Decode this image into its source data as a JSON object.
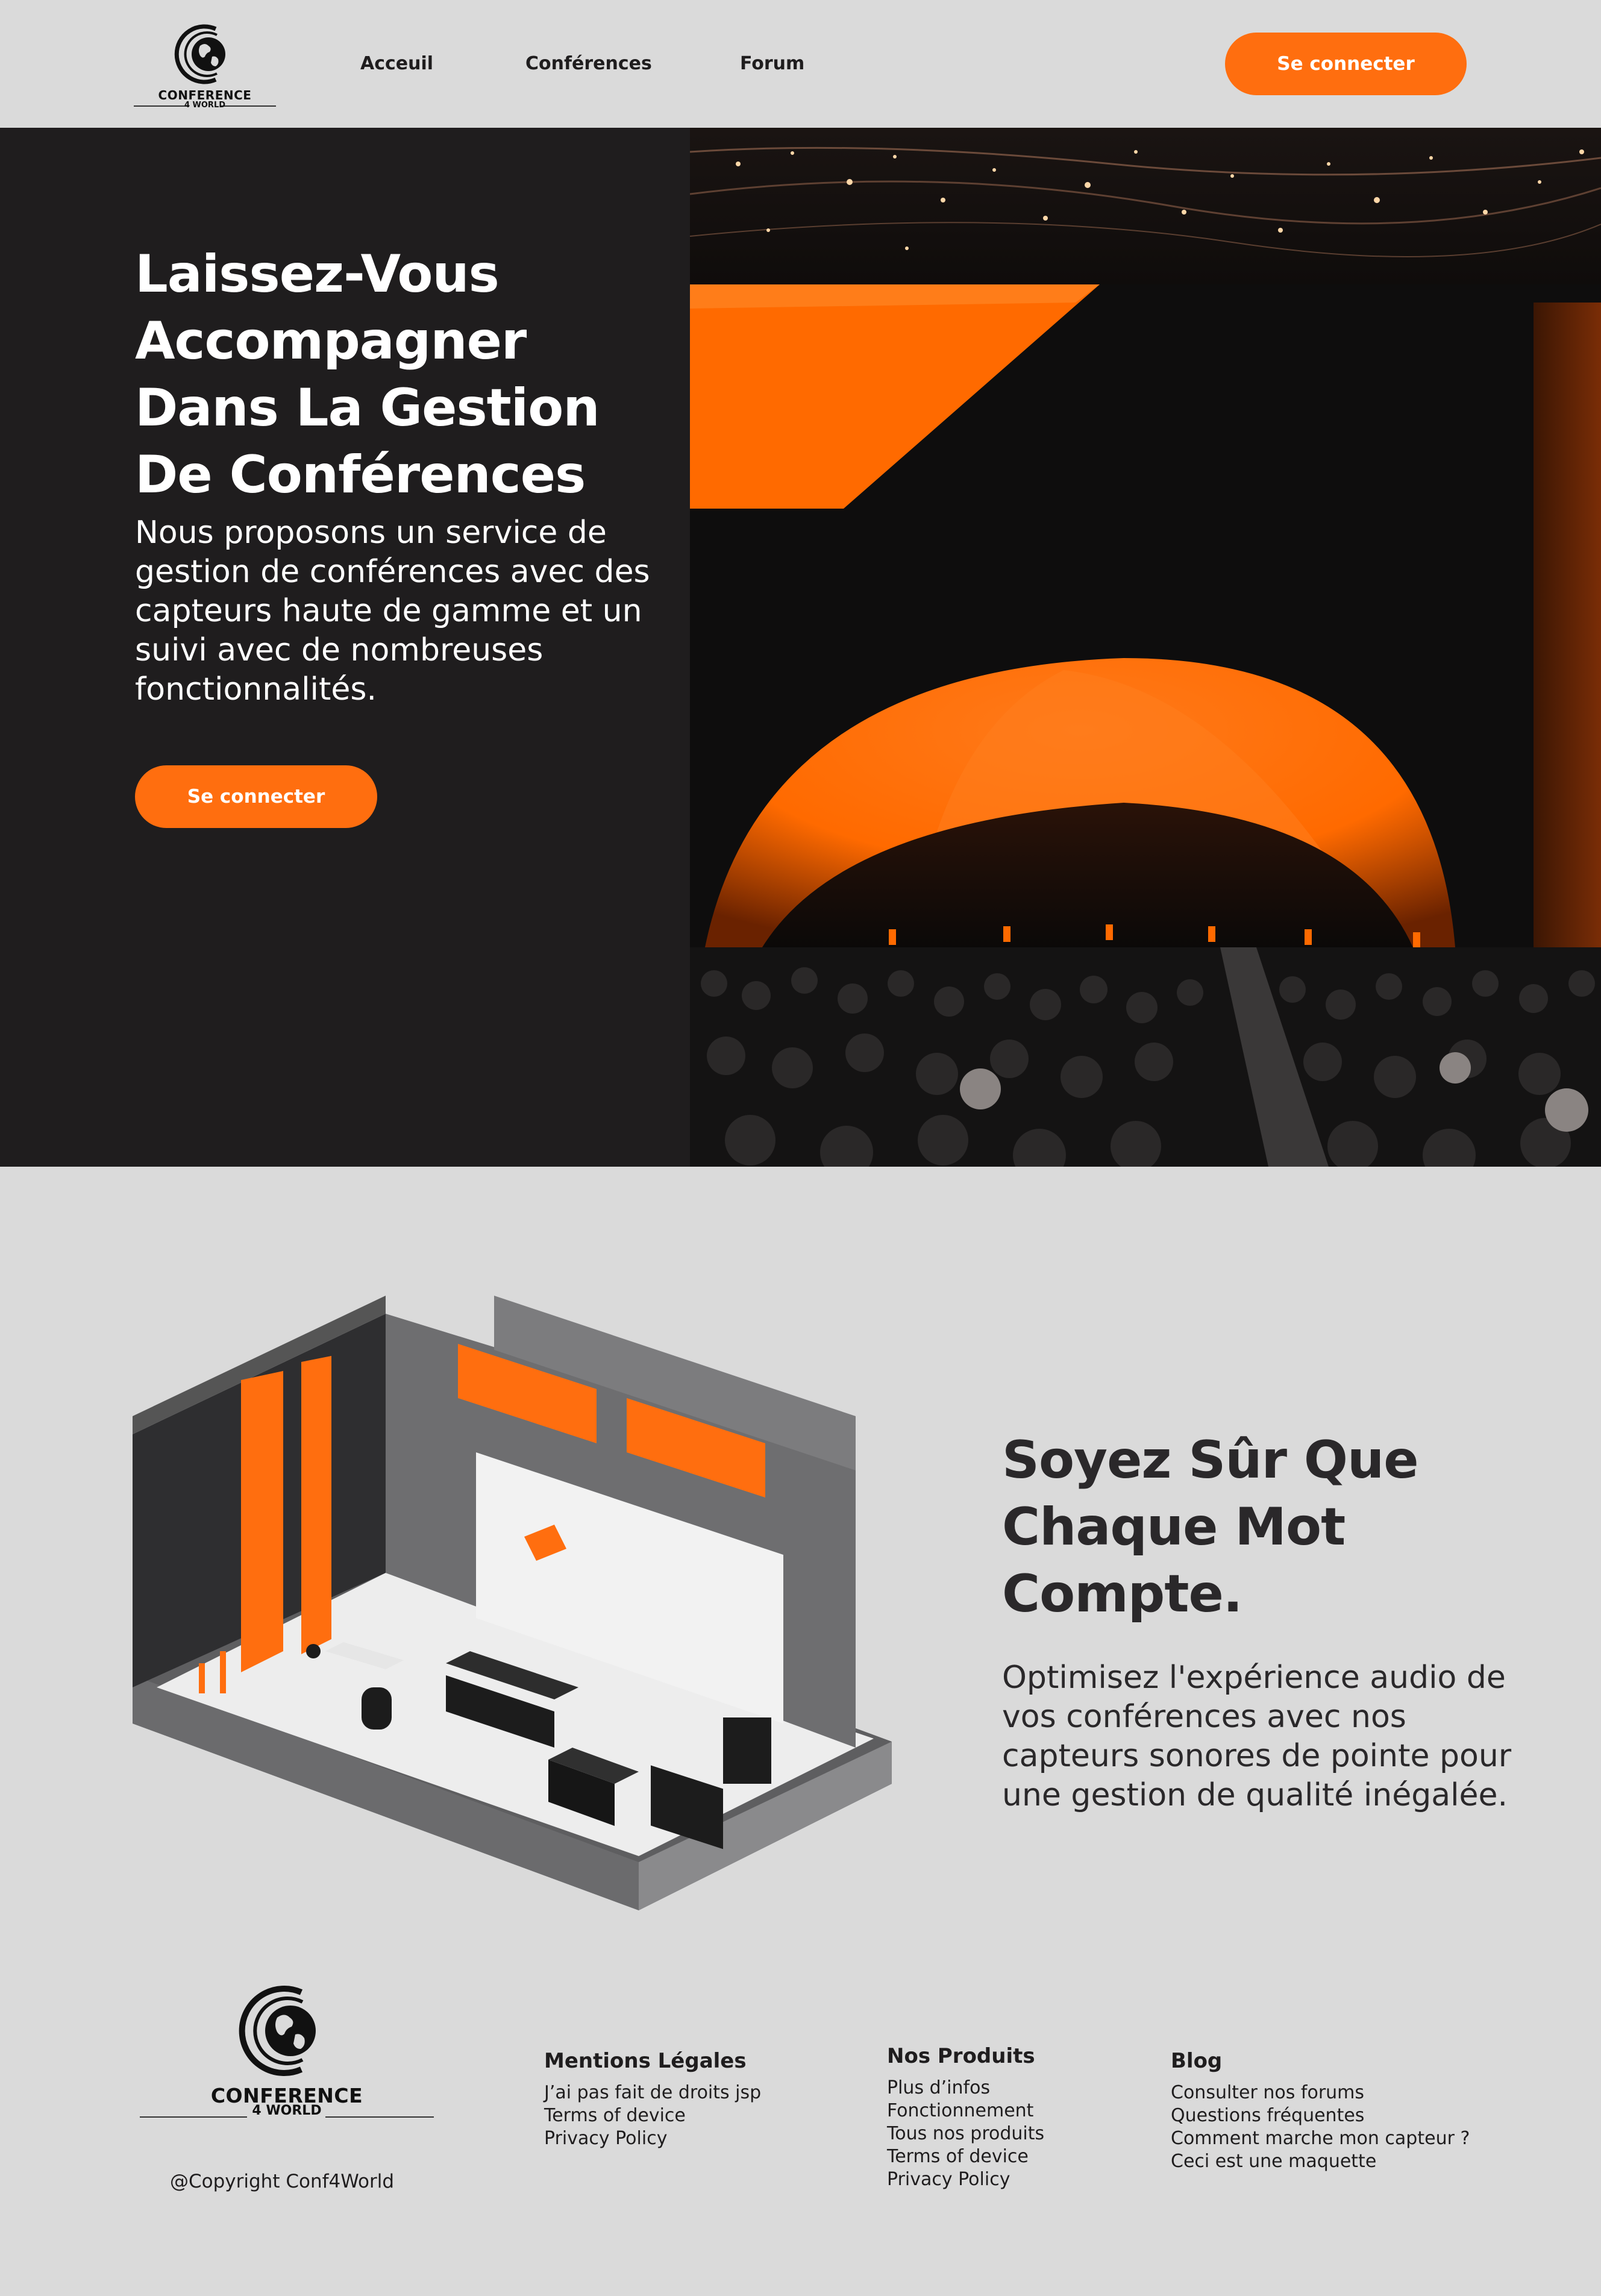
{
  "header": {
    "logo": {
      "line1": "CONFERENCE",
      "line2": "4 WORLD"
    },
    "nav": [
      "Acceuil",
      "Conférences",
      "Forum"
    ],
    "login_label": "Se connecter"
  },
  "hero": {
    "title": "Laissez-Vous Accompagner Dans La Gestion De Conférences",
    "text": "Nous proposons un service de gestion de conférences avec des capteurs haute de gamme et un suivi avec de nombreuses fonctionnalités.",
    "button_label": "Se connecter"
  },
  "section2": {
    "title": "Soyez Sûr Que Chaque Mot Compte.",
    "text": "Optimisez l'expérience audio de vos conférences avec nos capteurs sonores de pointe pour une gestion de qualité inégalée."
  },
  "footer": {
    "logo": {
      "line1": "CONFERENCE",
      "line2": "4 WORLD"
    },
    "copyright": "@Copyright Conf4World",
    "columns": [
      {
        "title": "Mentions Légales",
        "links": [
          "J’ai pas fait de droits jsp",
          "Terms of device",
          "Privacy Policy"
        ]
      },
      {
        "title": "Nos Produits",
        "links": [
          "Plus d’infos",
          "Fonctionnement",
          "Tous nos produits",
          "Terms of device",
          "Privacy Policy"
        ]
      },
      {
        "title": "Blog",
        "links": [
          "Consulter nos forums",
          "Questions fréquentes",
          "Comment marche mon capteur ?",
          "Ceci est une maquette"
        ]
      }
    ]
  },
  "colors": {
    "accent": "#ff6e0f",
    "dark": "#1f1d1e",
    "background": "#dadada",
    "white": "#ffffff"
  },
  "icons": [
    "globe-logo-icon"
  ]
}
